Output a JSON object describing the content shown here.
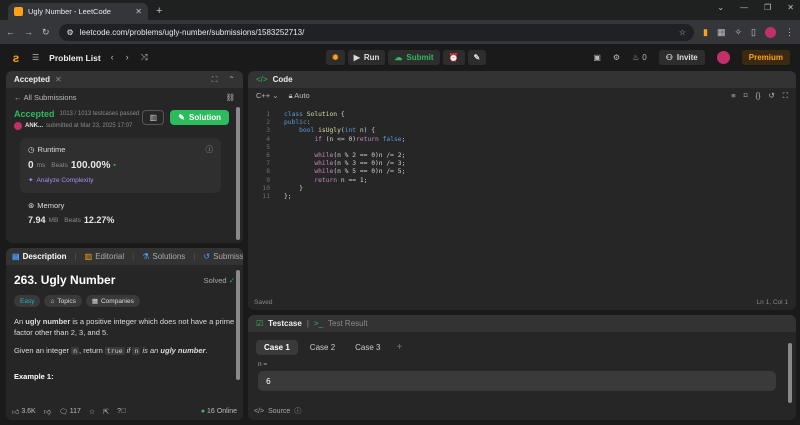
{
  "browser": {
    "tab_title": "Ugly Number - LeetCode",
    "url": "leetcode.com/problems/ugly-number/submissions/1583252713/",
    "new_tab": "+"
  },
  "nav": {
    "problem_list": "Problem List",
    "run": "Run",
    "submit": "Submit",
    "streak": "0",
    "invite": "Invite",
    "premium": "Premium"
  },
  "submission": {
    "tab": "Accepted",
    "back": "All Submissions",
    "status": "Accepted",
    "testcases": "1013 / 1013 testcases passed",
    "user": "ANK...",
    "submitted": "submitted at Mar 23, 2025 17:07",
    "solution_btn": "Solution",
    "runtime_label": "Runtime",
    "runtime_value": "0",
    "runtime_unit": "ms",
    "beats_label": "Beats",
    "runtime_beats": "100.00%",
    "analyze": "Analyze Complexity",
    "memory_label": "Memory",
    "memory_value": "7.94",
    "memory_unit": "MB",
    "memory_beats": "12.27%"
  },
  "description": {
    "tabs": [
      "Description",
      "Editorial",
      "Solutions",
      "Submissions"
    ],
    "title": "263. Ugly Number",
    "solved": "Solved",
    "tags": [
      "Easy",
      "Topics",
      "Companies"
    ],
    "p1_pre": "An ",
    "p1_bold": "ugly number",
    "p1_post": " is a positive integer which does not have a prime factor other than 2, 3, and 5.",
    "p2_pre": "Given an integer ",
    "p2_n": "n",
    "p2_mid": ", return ",
    "p2_true": "true",
    "p2_if": " if ",
    "p2_n2": "n",
    "p2_is": " is an ",
    "p2_bold": "ugly number",
    "p2_end": ".",
    "example": "Example 1:",
    "likes": "3.6K",
    "comments": "117",
    "online": "16 Online"
  },
  "editor": {
    "tab": "Code",
    "lang": "C++",
    "mode": "Auto",
    "status": "Saved",
    "cursor": "Ln 1, Col 1",
    "lines": [
      "class Solution {",
      "public:",
      "    bool isUgly(int n) {",
      "        if (n <= 0)return false;",
      "",
      "        while(n % 2 == 0)n /= 2;",
      "        while(n % 3 == 0)n /= 3;",
      "        while(n % 5 == 0)n /= 5;",
      "        return n == 1;",
      "    }",
      "};"
    ]
  },
  "testcase": {
    "tab1": "Testcase",
    "tab2": "Test Result",
    "cases": [
      "Case 1",
      "Case 2",
      "Case 3"
    ],
    "var_label": "n =",
    "var_value": "6",
    "source": "Source"
  },
  "colors": {
    "accent": "#ffa116",
    "green": "#2cbb5d"
  }
}
